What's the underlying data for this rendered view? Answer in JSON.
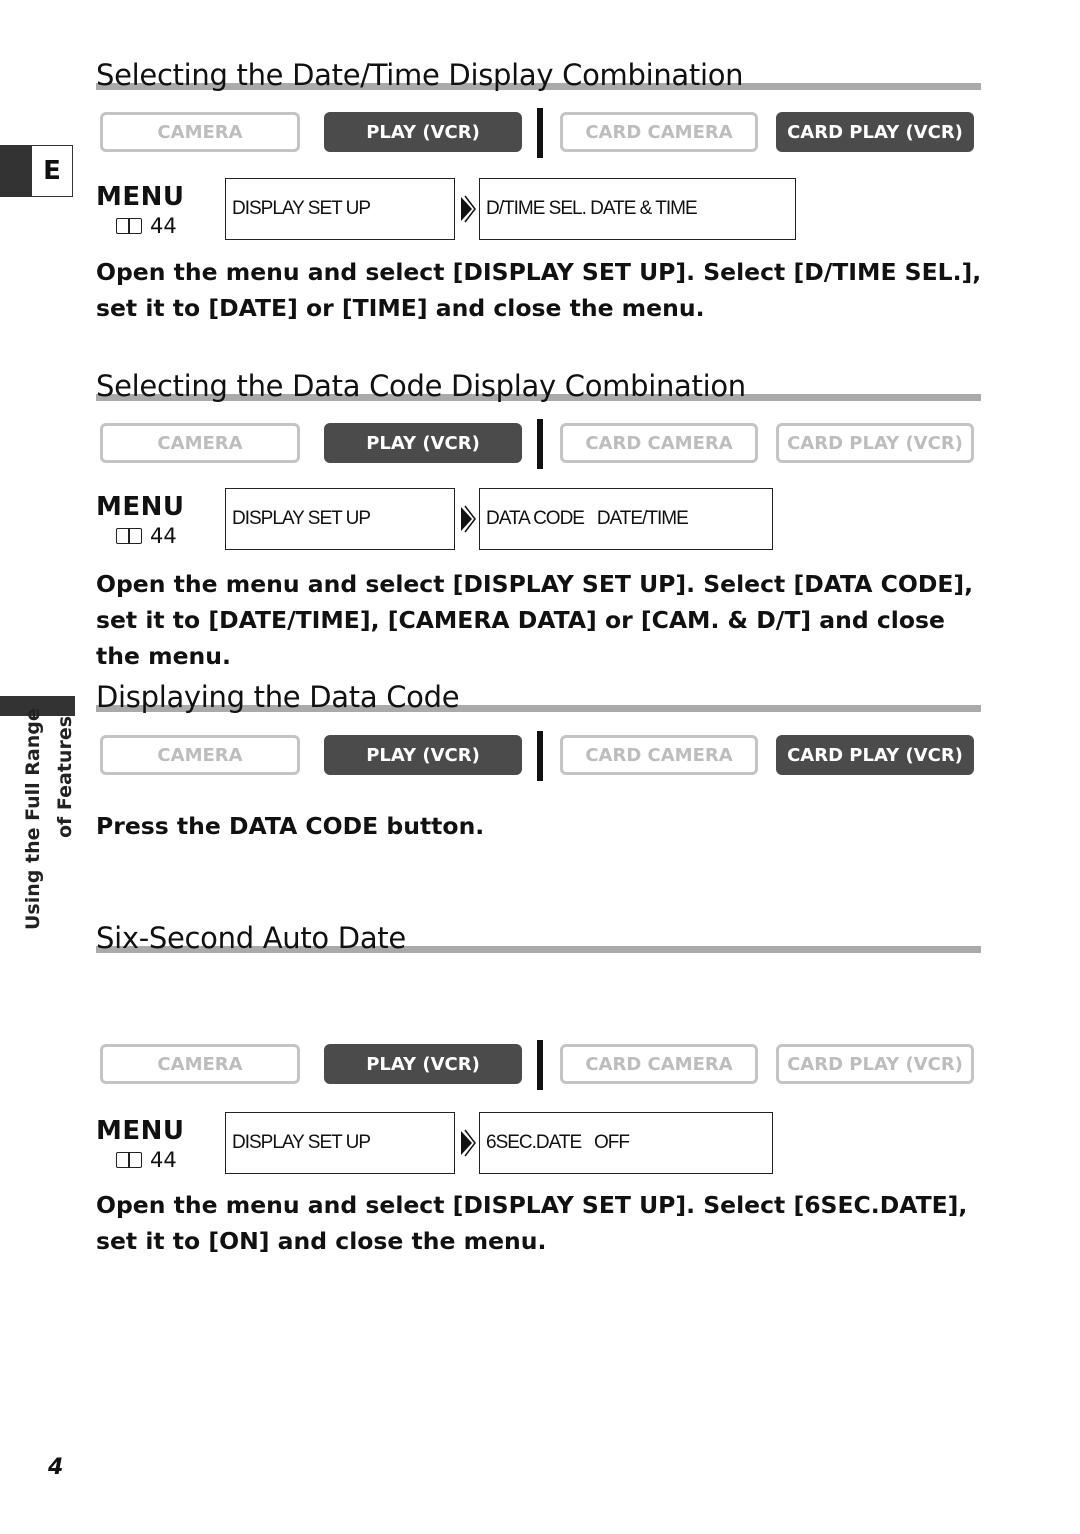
{
  "side_tab": {
    "letter": "E",
    "chapter_line1": "Using the Full Range",
    "chapter_line2": "of Features"
  },
  "page_number": "4",
  "colors": {
    "active_mode": "#4b4b4b",
    "inactive_mode": "#c4c4c4",
    "rule": "#aaaaaa"
  },
  "sections": [
    {
      "title": "Selecting the Date/Time Display Combination",
      "modes": [
        {
          "label": "CAMERA",
          "active": false
        },
        {
          "label": "PLAY (VCR)",
          "active": true
        },
        {
          "label": "CARD CAMERA",
          "active": false
        },
        {
          "label": "CARD PLAY (VCR)",
          "active": true
        }
      ],
      "menu": {
        "label": "MENU",
        "page_ref": "44",
        "icon": "book-icon",
        "step1": "DISPLAY SET UP",
        "step2": "D/TIME SEL. DATE & TIME"
      },
      "text": "Open the menu and select [DISPLAY SET UP]. Select [D/TIME SEL.], set it to [DATE] or [TIME] and close the menu."
    },
    {
      "title": "Selecting the Data Code Display Combination",
      "modes": [
        {
          "label": "CAMERA",
          "active": false
        },
        {
          "label": "PLAY (VCR)",
          "active": true
        },
        {
          "label": "CARD CAMERA",
          "active": false
        },
        {
          "label": "CARD PLAY (VCR)",
          "active": false
        }
      ],
      "menu": {
        "label": "MENU",
        "page_ref": "44",
        "icon": "book-icon",
        "step1": "DISPLAY SET UP",
        "step2": "DATA CODE   DATE/TIME"
      },
      "text": "Open the menu and select [DISPLAY SET UP]. Select [DATA CODE], set it to [DATE/TIME], [CAMERA DATA] or [CAM. & D/T] and close the menu."
    },
    {
      "title": "Displaying the Data Code",
      "modes": [
        {
          "label": "CAMERA",
          "active": false
        },
        {
          "label": "PLAY (VCR)",
          "active": true
        },
        {
          "label": "CARD CAMERA",
          "active": false
        },
        {
          "label": "CARD PLAY (VCR)",
          "active": true
        }
      ],
      "text": "Press the DATA CODE button."
    },
    {
      "title": "Six-Second Auto Date",
      "modes": [
        {
          "label": "CAMERA",
          "active": false
        },
        {
          "label": "PLAY (VCR)",
          "active": true
        },
        {
          "label": "CARD CAMERA",
          "active": false
        },
        {
          "label": "CARD PLAY (VCR)",
          "active": false
        }
      ],
      "menu": {
        "label": "MENU",
        "page_ref": "44",
        "icon": "book-icon",
        "step1": "DISPLAY SET UP",
        "step2": "6SEC.DATE   OFF"
      },
      "text": "Open the menu and select [DISPLAY SET UP]. Select [6SEC.DATE], set it to [ON] and close the menu."
    }
  ]
}
